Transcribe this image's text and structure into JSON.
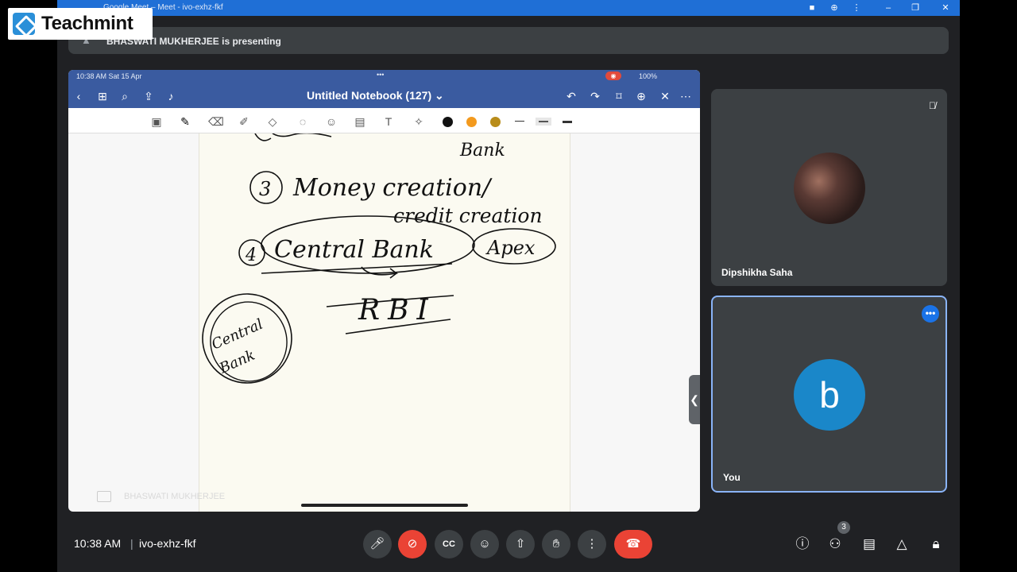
{
  "browser": {
    "tab_title": "Google Meet – Meet - ivo-exhz-fkf"
  },
  "logo": {
    "text": "Teachmint"
  },
  "banner": {
    "text": "BHASWATI MUKHERJEE is presenting"
  },
  "ipad": {
    "status_time": "10:38 AM  Sat 15 Apr",
    "status_dots": "•••",
    "battery": "100%",
    "notebook_title": "Untitled Notebook (127)",
    "title_chevron": "⌄",
    "presenter_label": "BHASWATI MUKHERJEE"
  },
  "pen_colors": [
    "#111111",
    "#f39a1e",
    "#b88c1a"
  ],
  "handwriting": {
    "line1_fragment": "Bank",
    "item3_number": "3",
    "item3_line1": "Money creation/",
    "item3_line2": "credit creation",
    "item4_number": "4",
    "item4_text": "Central   Bank",
    "apex": "Apex",
    "rbi": "RBI",
    "circle_line1": "Central",
    "circle_line2": "Bank"
  },
  "participants": [
    {
      "name": "Dipshikha Saha",
      "muted": true
    },
    {
      "name": "You",
      "initial": "b"
    }
  ],
  "bottom": {
    "time": "10:38 AM",
    "meeting_code": "ivo-exhz-fkf",
    "people_count": "3"
  }
}
